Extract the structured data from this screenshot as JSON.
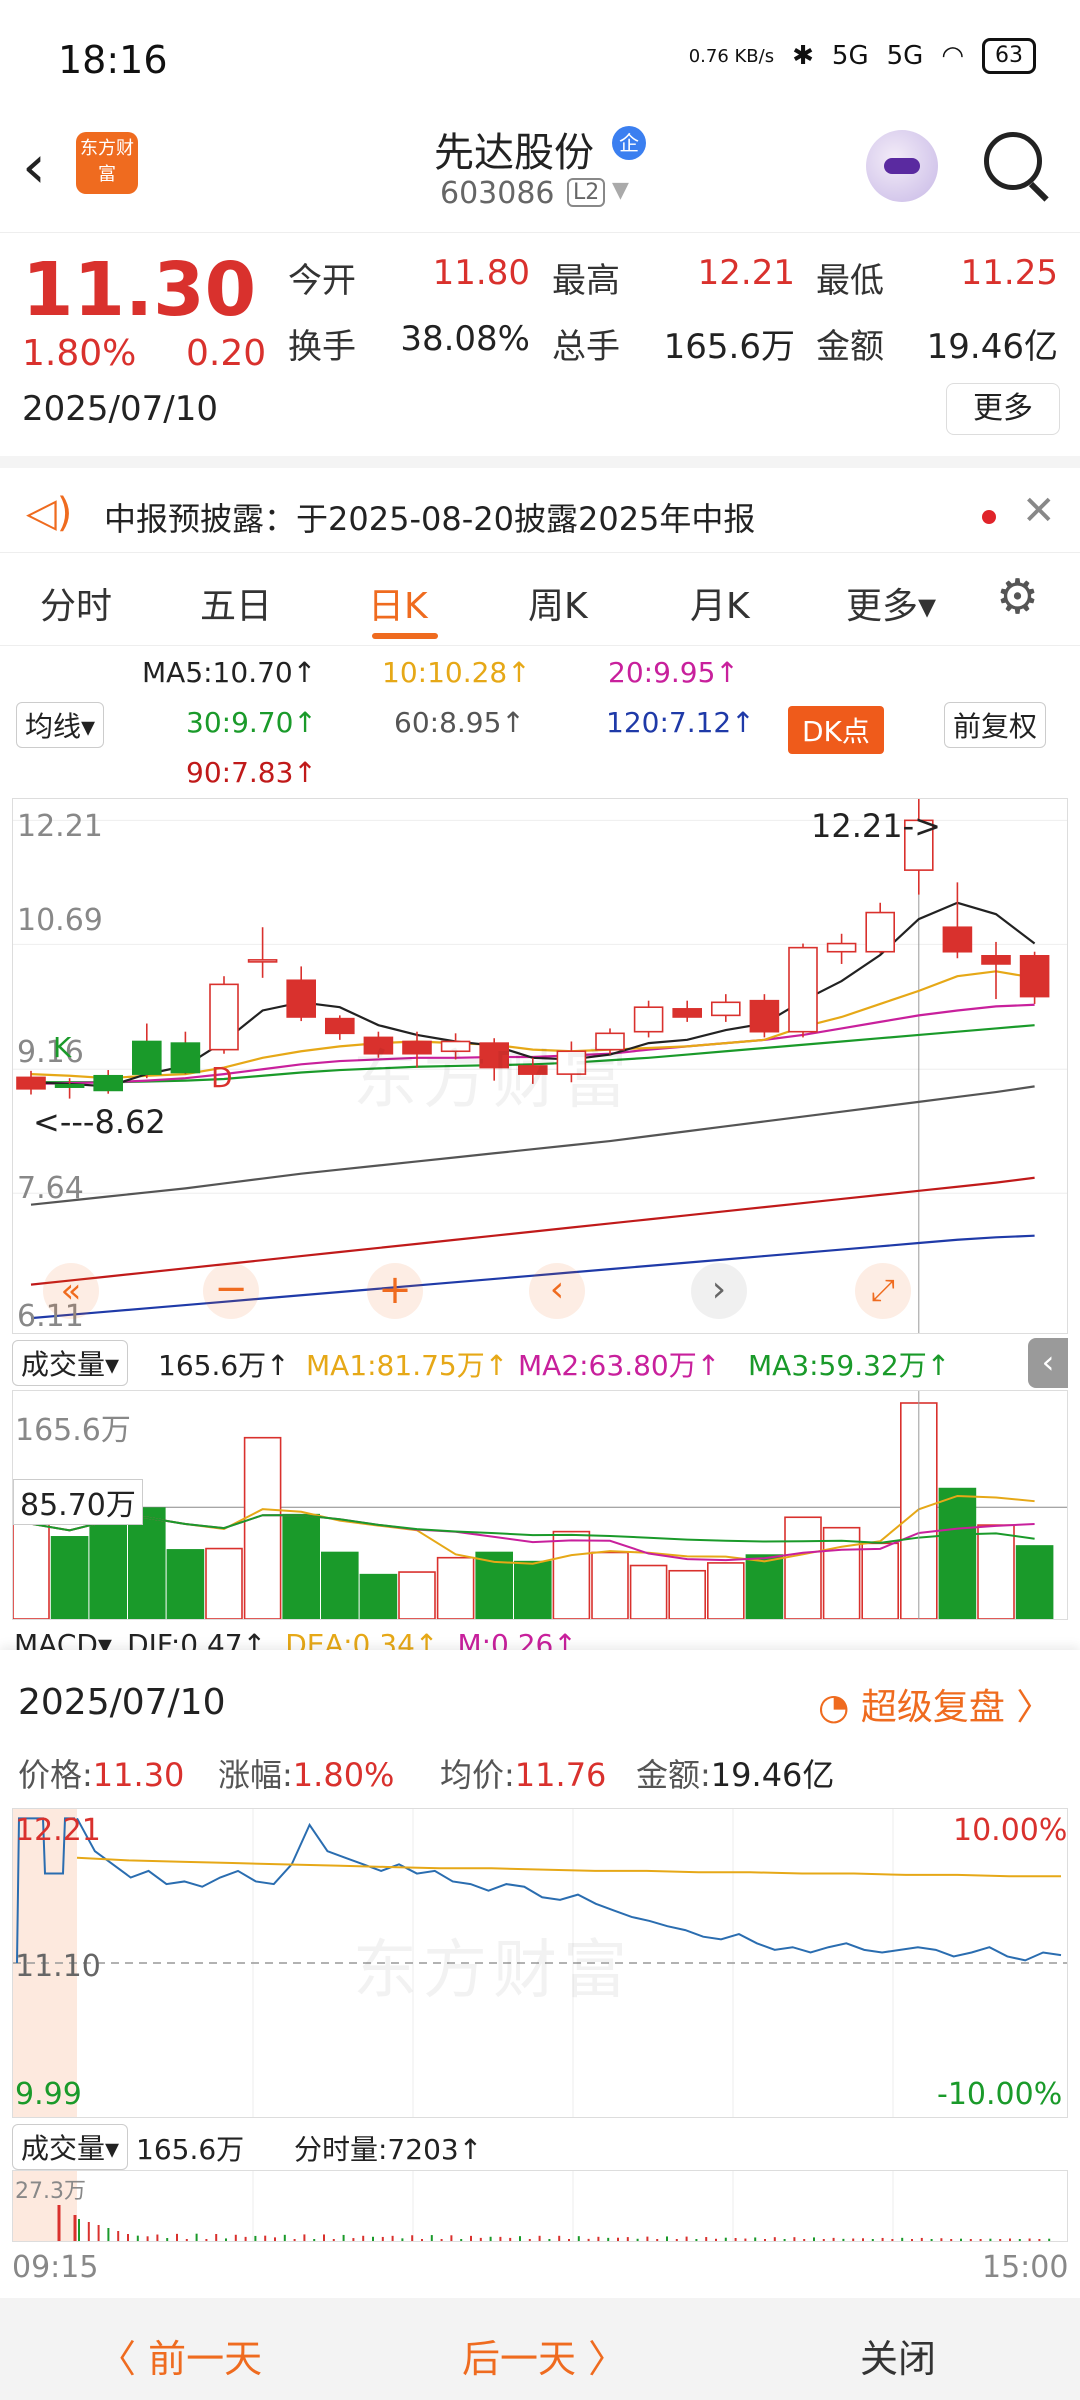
{
  "status_bar": {
    "time": "18:16",
    "net_speed": "0.76 KB/s",
    "signal1": "5G",
    "signal2": "5G",
    "battery": "63"
  },
  "header": {
    "logo": "东方财富",
    "name": "先达股份",
    "badge": "企",
    "code": "603086",
    "level": "L2"
  },
  "quote": {
    "price": "11.30",
    "change_pct": "1.80%",
    "change": "0.20",
    "date": "2025/07/10",
    "stats": [
      {
        "label": "今开",
        "value": "11.80"
      },
      {
        "label": "最高",
        "value": "12.21"
      },
      {
        "label": "最低",
        "value": "11.25"
      },
      {
        "label": "换手",
        "value": "38.08%"
      },
      {
        "label": "总手",
        "value": "165.6万"
      },
      {
        "label": "金额",
        "value": "19.46亿"
      }
    ],
    "more_label": "更多"
  },
  "notice": {
    "text": "中报预披露：于2025-08-20披露2025年中报"
  },
  "tabs": [
    {
      "label": "分时"
    },
    {
      "label": "五日"
    },
    {
      "label": "日K"
    },
    {
      "label": "周K"
    },
    {
      "label": "月K"
    },
    {
      "label": "更多▾"
    }
  ],
  "ma_legend": {
    "select": "均线▾",
    "ma5": "MA5:10.70↑",
    "ma10": "10:10.28↑",
    "ma20": "20:9.95↑",
    "ma30": "30:9.70↑",
    "ma60": "60:8.95↑",
    "ma120": "120:7.12↑",
    "ma90": "90:7.83↑",
    "dk_label": "DK点",
    "fq_label": "前复权"
  },
  "kline": {
    "y_labels": [
      "12.21",
      "10.69",
      "9.16",
      "7.64",
      "6.11"
    ],
    "high_annotation": "12.21->",
    "low_annotation": "<---8.62",
    "marker_k": "K",
    "marker_d": "D",
    "watermark": "东方财富",
    "candles": [
      {
        "o": 9.06,
        "c": 8.92,
        "h": 9.14,
        "l": 8.85,
        "v": 73
      },
      {
        "o": 8.94,
        "c": 8.97,
        "h": 9.05,
        "l": 8.8,
        "v": 63
      },
      {
        "o": 8.9,
        "c": 9.08,
        "h": 9.15,
        "l": 8.86,
        "v": 90
      },
      {
        "o": 9.1,
        "c": 9.5,
        "h": 9.72,
        "l": 9.05,
        "v": 85
      },
      {
        "o": 9.12,
        "c": 9.48,
        "h": 9.62,
        "l": 9.1,
        "v": 53
      },
      {
        "o": 9.4,
        "c": 10.2,
        "h": 10.3,
        "l": 9.35,
        "v": 54
      },
      {
        "o": 10.5,
        "c": 10.5,
        "h": 10.9,
        "l": 10.28,
        "v": 139
      },
      {
        "o": 10.25,
        "c": 9.8,
        "h": 10.42,
        "l": 9.75,
        "v": 80
      },
      {
        "o": 9.78,
        "c": 9.6,
        "h": 9.82,
        "l": 9.52,
        "v": 51
      },
      {
        "o": 9.55,
        "c": 9.35,
        "h": 9.62,
        "l": 9.3,
        "v": 34
      },
      {
        "o": 9.5,
        "c": 9.35,
        "h": 9.62,
        "l": 9.18,
        "v": 36
      },
      {
        "o": 9.38,
        "c": 9.5,
        "h": 9.6,
        "l": 9.28,
        "v": 47
      },
      {
        "o": 9.48,
        "c": 9.18,
        "h": 9.54,
        "l": 9.02,
        "v": 51
      },
      {
        "o": 9.2,
        "c": 9.1,
        "h": 9.3,
        "l": 8.98,
        "v": 44
      },
      {
        "o": 9.1,
        "c": 9.38,
        "h": 9.5,
        "l": 9.0,
        "v": 67
      },
      {
        "o": 9.4,
        "c": 9.6,
        "h": 9.66,
        "l": 9.34,
        "v": 51
      },
      {
        "o": 9.62,
        "c": 9.92,
        "h": 10.0,
        "l": 9.55,
        "v": 41
      },
      {
        "o": 9.9,
        "c": 9.8,
        "h": 10.0,
        "l": 9.74,
        "v": 37
      },
      {
        "o": 9.82,
        "c": 9.98,
        "h": 10.08,
        "l": 9.74,
        "v": 43
      },
      {
        "o": 10.0,
        "c": 9.62,
        "h": 10.08,
        "l": 9.55,
        "v": 49
      },
      {
        "o": 9.62,
        "c": 10.65,
        "h": 10.7,
        "l": 9.55,
        "v": 78
      },
      {
        "o": 10.6,
        "c": 10.7,
        "h": 10.82,
        "l": 10.45,
        "v": 70
      },
      {
        "o": 10.6,
        "c": 11.08,
        "h": 11.2,
        "l": 10.58,
        "v": 58
      },
      {
        "o": 11.6,
        "c": 12.21,
        "h": 12.6,
        "l": 11.3,
        "v": 165.6
      },
      {
        "o": 10.9,
        "c": 10.6,
        "h": 11.45,
        "l": 10.52,
        "v": 100
      },
      {
        "o": 10.55,
        "c": 10.45,
        "h": 10.72,
        "l": 10.02,
        "v": 72
      },
      {
        "o": 10.55,
        "c": 10.05,
        "h": 10.6,
        "l": 9.96,
        "v": 56
      }
    ],
    "ma_lines": {
      "ma5": [
        9.0,
        8.98,
        8.95,
        9.1,
        9.2,
        9.5,
        9.88,
        9.98,
        9.92,
        9.7,
        9.58,
        9.5,
        9.45,
        9.3,
        9.28,
        9.34,
        9.48,
        9.52,
        9.64,
        9.72,
        10.0,
        10.24,
        10.56,
        11.0,
        11.2,
        11.06,
        10.7
      ],
      "ma10": [
        9.1,
        9.08,
        9.05,
        9.08,
        9.1,
        9.18,
        9.3,
        9.38,
        9.44,
        9.48,
        9.5,
        9.48,
        9.46,
        9.4,
        9.38,
        9.4,
        9.42,
        9.44,
        9.48,
        9.52,
        9.68,
        9.8,
        9.96,
        10.12,
        10.3,
        10.36,
        10.28
      ],
      "ma20": [
        8.98,
        8.99,
        9.0,
        9.02,
        9.05,
        9.1,
        9.16,
        9.22,
        9.26,
        9.28,
        9.3,
        9.3,
        9.31,
        9.31,
        9.33,
        9.35,
        9.4,
        9.44,
        9.48,
        9.52,
        9.58,
        9.66,
        9.74,
        9.82,
        9.88,
        9.93,
        9.95
      ],
      "ma30": [
        9.0,
        9.0,
        9.0,
        9.01,
        9.02,
        9.04,
        9.08,
        9.12,
        9.15,
        9.17,
        9.19,
        9.2,
        9.21,
        9.22,
        9.24,
        9.27,
        9.3,
        9.34,
        9.38,
        9.42,
        9.46,
        9.5,
        9.54,
        9.58,
        9.62,
        9.66,
        9.7
      ],
      "ma60": [
        7.5,
        7.55,
        7.6,
        7.65,
        7.7,
        7.76,
        7.82,
        7.88,
        7.93,
        7.98,
        8.03,
        8.08,
        8.13,
        8.18,
        8.23,
        8.28,
        8.34,
        8.4,
        8.46,
        8.52,
        8.58,
        8.64,
        8.7,
        8.76,
        8.82,
        8.88,
        8.95
      ],
      "ma90": [
        6.52,
        6.57,
        6.62,
        6.67,
        6.72,
        6.77,
        6.82,
        6.87,
        6.92,
        6.97,
        7.02,
        7.07,
        7.12,
        7.17,
        7.22,
        7.27,
        7.32,
        7.37,
        7.42,
        7.47,
        7.52,
        7.57,
        7.62,
        7.67,
        7.72,
        7.77,
        7.83
      ],
      "ma120": [
        6.11,
        6.15,
        6.19,
        6.23,
        6.27,
        6.31,
        6.35,
        6.39,
        6.43,
        6.47,
        6.51,
        6.55,
        6.59,
        6.63,
        6.67,
        6.71,
        6.75,
        6.79,
        6.83,
        6.87,
        6.91,
        6.95,
        6.99,
        7.03,
        7.07,
        7.1,
        7.12
      ]
    }
  },
  "volume": {
    "select": "成交量▾",
    "current": "165.6万↑",
    "ma1": "MA1:81.75万↑",
    "ma2": "MA2:63.80万↑",
    "ma3": "MA3:59.32万↑",
    "max_label": "165.6万",
    "tag_label": "85.70万"
  },
  "macd": {
    "select": "MACD▾",
    "dif": "DIF:0.47↑",
    "dea": "DEA:0.34↑",
    "m": "M:0.26↑"
  },
  "detail": {
    "date": "2025/07/10",
    "replay": "超级复盘 〉",
    "items": [
      {
        "label": "价格:",
        "value": "11.30"
      },
      {
        "label": "涨幅:",
        "value": "1.80%"
      },
      {
        "label": "均价:",
        "value": "11.76"
      },
      {
        "label": "金额:",
        "value": "19.46亿"
      }
    ]
  },
  "intraday": {
    "top": "12.21",
    "mid": "11.10",
    "bottom": "9.99",
    "pos_pct": "10.00%",
    "neg_pct": "-10.00%",
    "vol_select": "成交量▾",
    "vol_total": "165.6万",
    "tick_vol": "分时量:7203↑",
    "vol_max": "27.3万",
    "start_time": "09:15",
    "end_time": "15:00",
    "prices": [
      12.2,
      11.95,
      11.85,
      11.75,
      11.8,
      11.7,
      11.72,
      11.68,
      11.75,
      11.8,
      11.72,
      11.7,
      11.85,
      12.15,
      11.95,
      11.9,
      11.85,
      11.8,
      11.85,
      11.78,
      11.8,
      11.72,
      11.7,
      11.65,
      11.7,
      11.68,
      11.6,
      11.58,
      11.62,
      11.55,
      11.5,
      11.45,
      11.42,
      11.38,
      11.35,
      11.3,
      11.28,
      11.32,
      11.25,
      11.2,
      11.22,
      11.18,
      11.22,
      11.25,
      11.2,
      11.18,
      11.2,
      11.22,
      11.2,
      11.15,
      11.18,
      11.22,
      11.15,
      11.12,
      11.18,
      11.16
    ],
    "avg": [
      11.9,
      11.88,
      11.87,
      11.86,
      11.85,
      11.84,
      11.83,
      11.82,
      11.82,
      11.81,
      11.8,
      11.8,
      11.79,
      11.79,
      11.78,
      11.78,
      11.77,
      11.77,
      11.76,
      11.76
    ]
  },
  "bottom_nav": {
    "prev": "〈 前一天",
    "next": "后一天 〉",
    "close": "关闭"
  }
}
